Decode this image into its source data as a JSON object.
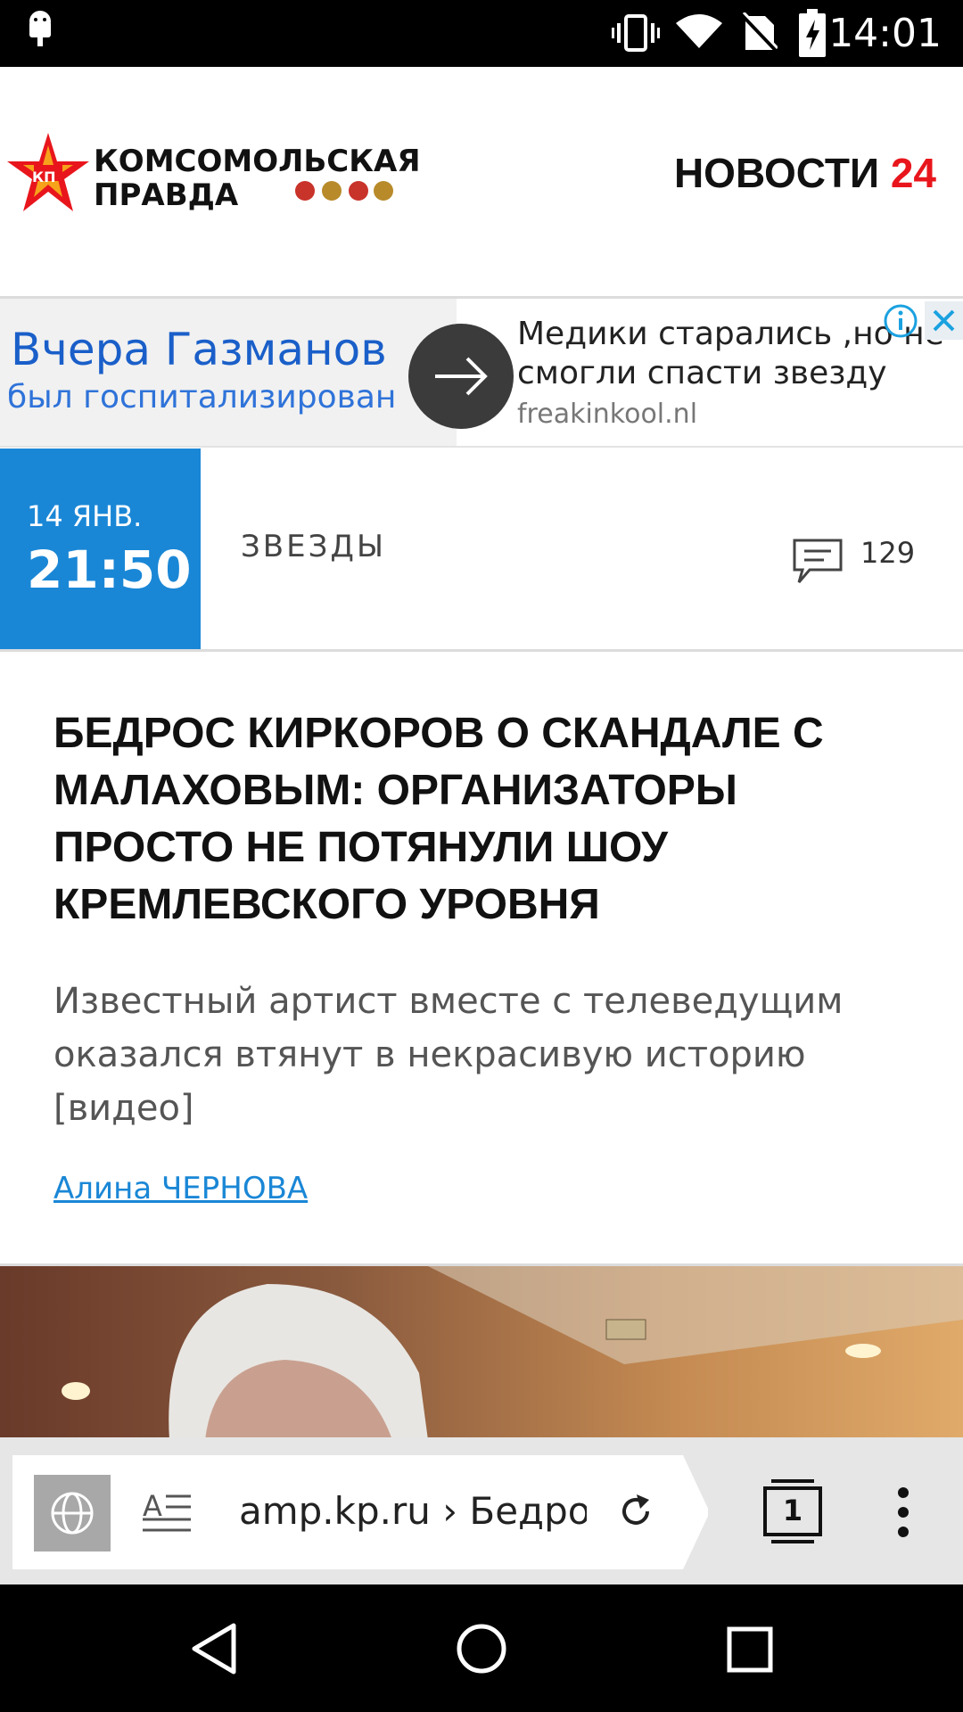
{
  "status_bar": {
    "time": "14:01"
  },
  "header": {
    "logo_badge": "КП",
    "logo_line1": "КОМСОМОЛЬСКАЯ",
    "logo_line2": "ПРАВДА",
    "news_label": "НОВОСТИ",
    "news_num": "24"
  },
  "ad": {
    "left_line1": "Вчера Газманов",
    "left_line2": "был госпитализирован",
    "right_line1": "Медики старались ,но не",
    "right_line2": "смогли спасти звезду",
    "domain": "freakinkool.nl"
  },
  "meta": {
    "date": "14 ЯНВ.",
    "time": "21:50",
    "category": "ЗВЕЗДЫ",
    "comments": "129"
  },
  "article": {
    "title": "БЕДРОС КИРКОРОВ О СКАНДАЛЕ С МАЛАХОВЫМ: ОРГАНИЗАТОРЫ ПРОСТО НЕ ПОТЯНУЛИ ШОУ КРЕМЛЕВСКОГО УРОВНЯ",
    "lead": "Известный артист вместе с телеведущим оказался втянут в некрасивую историю [видео]",
    "author": "Алина ЧЕРНОВА"
  },
  "browser": {
    "url": "amp.kp.ru › Бедрос",
    "tab_count": "1"
  },
  "colors": {
    "accent_blue": "#1a87d6",
    "brand_red": "#e8161c",
    "ad_link_blue": "#1a5fc9"
  }
}
